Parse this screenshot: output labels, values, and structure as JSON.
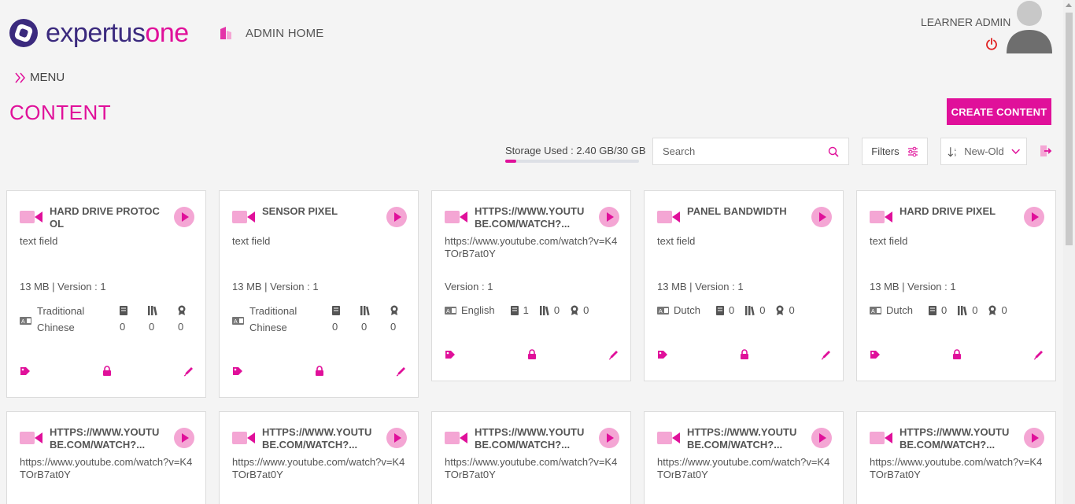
{
  "header": {
    "logo_main": "expertus",
    "logo_accent": "one",
    "admin_home": "ADMIN HOME",
    "user_name": "LEARNER ADMIN"
  },
  "menu_label": "MENU",
  "page_title": "CONTENT",
  "create_button": "CREATE CONTENT",
  "storage": {
    "label": "Storage Used : 2.40 GB/30 GB",
    "used_fraction": 0.08
  },
  "search": {
    "placeholder": "Search"
  },
  "filters_label": "Filters",
  "sort": {
    "selected": "New-Old"
  },
  "colors": {
    "accent": "#e0109a",
    "accent_light": "#f4a6d4",
    "brand": "#3b2a7e"
  },
  "cards": [
    {
      "title": "HARD DRIVE PROTOCOL",
      "desc": "text field",
      "meta": "13 MB | Version : 1",
      "language": "Traditional Chinese",
      "stack": true,
      "books": "0",
      "libraries": "0",
      "badges": "0"
    },
    {
      "title": "SENSOR PIXEL",
      "desc": "text field",
      "meta": "13 MB | Version : 1",
      "language": "Traditional Chinese",
      "stack": true,
      "books": "0",
      "libraries": "0",
      "badges": "0"
    },
    {
      "title": "HTTPS://WWW.YOUTUBE.COM/WATCH?...",
      "desc": "https://www.youtube.com/watch?v=K4TOrB7at0Y",
      "meta": "Version : 1",
      "language": "English",
      "stack": false,
      "books": "1",
      "libraries": "0",
      "badges": "0"
    },
    {
      "title": "PANEL BANDWIDTH",
      "desc": "text field",
      "meta": "13 MB | Version : 1",
      "language": "Dutch",
      "stack": false,
      "books": "0",
      "libraries": "0",
      "badges": "0"
    },
    {
      "title": "HARD DRIVE PIXEL",
      "desc": "text field",
      "meta": "13 MB | Version : 1",
      "language": "Dutch",
      "stack": false,
      "books": "0",
      "libraries": "0",
      "badges": "0"
    },
    {
      "title": "HTTPS://WWW.YOUTUBE.COM/WATCH?...",
      "desc": "https://www.youtube.com/watch?v=K4TOrB7at0Y"
    },
    {
      "title": "HTTPS://WWW.YOUTUBE.COM/WATCH?...",
      "desc": "https://www.youtube.com/watch?v=K4TOrB7at0Y"
    },
    {
      "title": "HTTPS://WWW.YOUTUBE.COM/WATCH?...",
      "desc": "https://www.youtube.com/watch?v=K4TOrB7at0Y"
    },
    {
      "title": "HTTPS://WWW.YOUTUBE.COM/WATCH?...",
      "desc": "https://www.youtube.com/watch?v=K4TOrB7at0Y"
    },
    {
      "title": "HTTPS://WWW.YOUTUBE.COM/WATCH?...",
      "desc": "https://www.youtube.com/watch?v=K4TOrB7at0Y"
    }
  ]
}
